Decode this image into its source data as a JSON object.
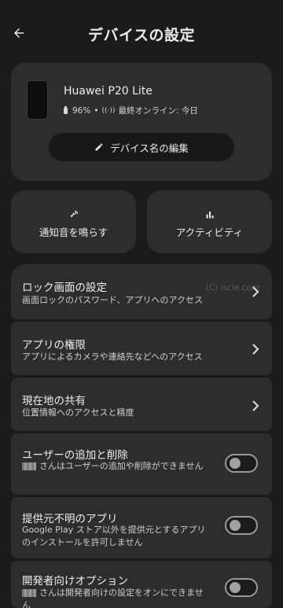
{
  "header": {
    "title": "デバイスの設定",
    "back_icon": "arrow-back-icon"
  },
  "device": {
    "name": "Huawei P20 Lite",
    "battery": "96%",
    "separator": "•",
    "last_online": "最終オンライン: 今日",
    "rename_label": "デバイス名の編集"
  },
  "actions": {
    "ring_label": "通知音を鳴らす",
    "activity_label": "アクティビティ"
  },
  "watermark": "(C) iscle.com",
  "settings": {
    "lock": {
      "title": "ロック画面の設定",
      "subtitle": "画面ロックのパスワード、アプリへのアクセス"
    },
    "permissions": {
      "title": "アプリの権限",
      "subtitle": "アプリによるカメラや連絡先などへのアクセス"
    },
    "location": {
      "title": "現在地の共有",
      "subtitle": "位置情報へのアクセスと精度"
    },
    "users": {
      "title": "ユーザーの追加と削除",
      "subtitle": "さんはユーザーの追加や削除ができません",
      "enabled": false
    },
    "unknown_sources": {
      "title": "提供元不明のアプリ",
      "subtitle": "Google Play ストア以外を提供元とするアプリのインストールを許可しません",
      "enabled": false
    },
    "developer": {
      "title": "開発者向けオプション",
      "subtitle": "さんは開発者向けの設定をオンにできません",
      "enabled": false
    }
  },
  "colors": {
    "background": "#1b1b1b",
    "card": "#2d2d2d",
    "button_dark": "#181818",
    "text": "#ececec"
  }
}
